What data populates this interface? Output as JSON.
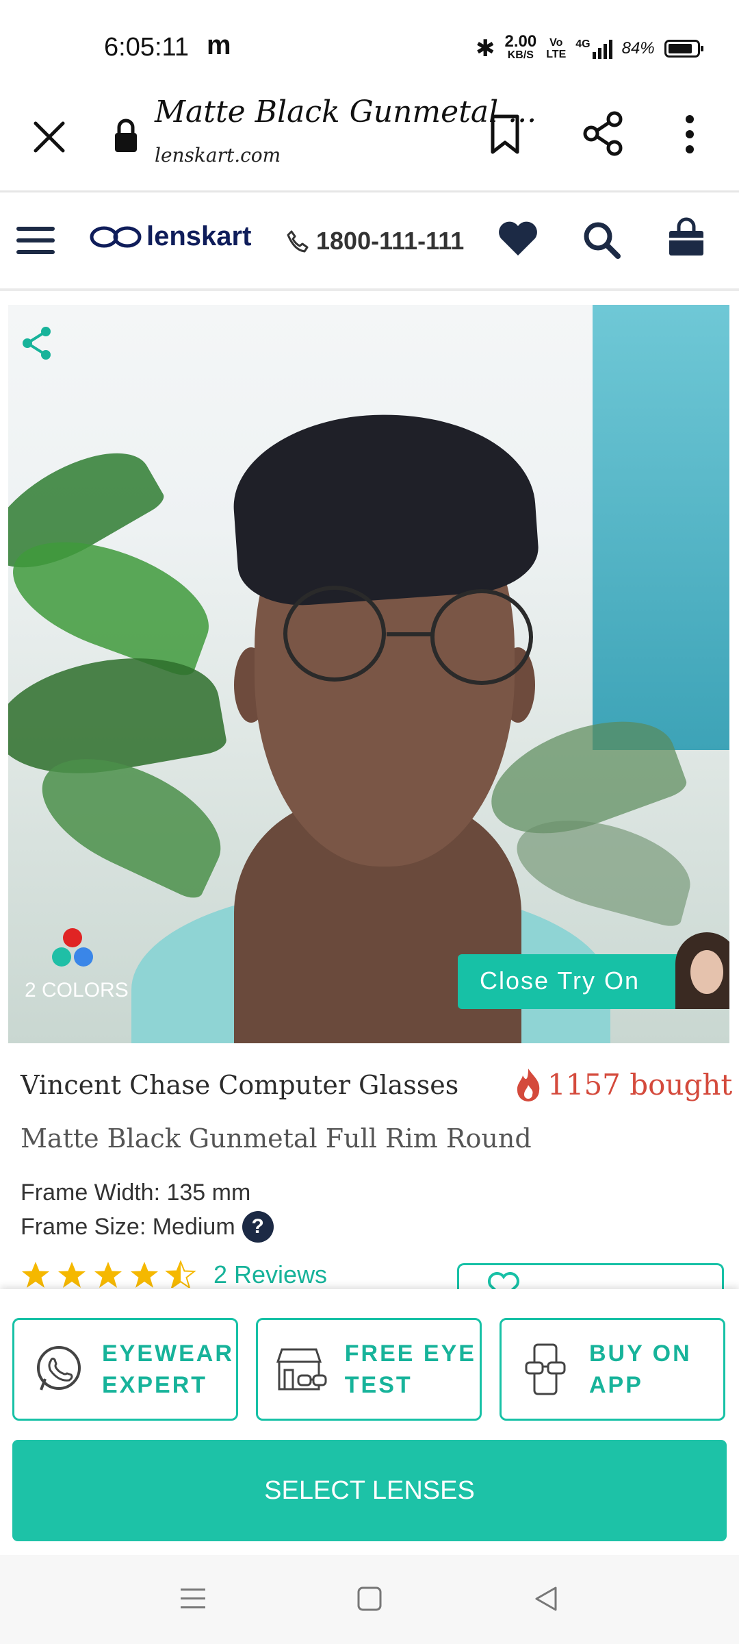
{
  "status_bar": {
    "time": "6:05:11",
    "app_letter": "m",
    "net_speed_top": "2.00",
    "net_speed_bottom": "KB/S",
    "volte_top": "Vo",
    "volte_bottom": "LTE",
    "network": "4G",
    "battery": "84%"
  },
  "browser": {
    "page_title": "Matte Black Gunmetal ...",
    "domain": "lenskart.com"
  },
  "site_header": {
    "brand": "lenskart",
    "phone": "1800-111-111"
  },
  "product_image": {
    "colors_label": "2 COLORS",
    "color_dots": [
      "#e02424",
      "#1fbfa6",
      "#3a86e8"
    ],
    "try_on_label": "Close Try On"
  },
  "product": {
    "title": "Vincent Chase Computer Glasses",
    "bought": "1157 bought",
    "subtitle": "Matte Black Gunmetal Full Rim Round",
    "frame_width": "Frame Width: 135 mm",
    "frame_size": "Frame Size: Medium",
    "help_symbol": "?",
    "rating": 4.5,
    "reviews": "2 Reviews"
  },
  "actions": {
    "eyewear_expert": "EYEWEAR EXPERT",
    "free_eye_test": "FREE EYE TEST",
    "buy_on_app": "BUY ON APP",
    "select_lenses": "SELECT LENSES"
  },
  "colors": {
    "accent": "#1dc2a7",
    "brand_navy": "#0f1d5a",
    "bought_red": "#d44a3c",
    "star": "#f5b800"
  }
}
